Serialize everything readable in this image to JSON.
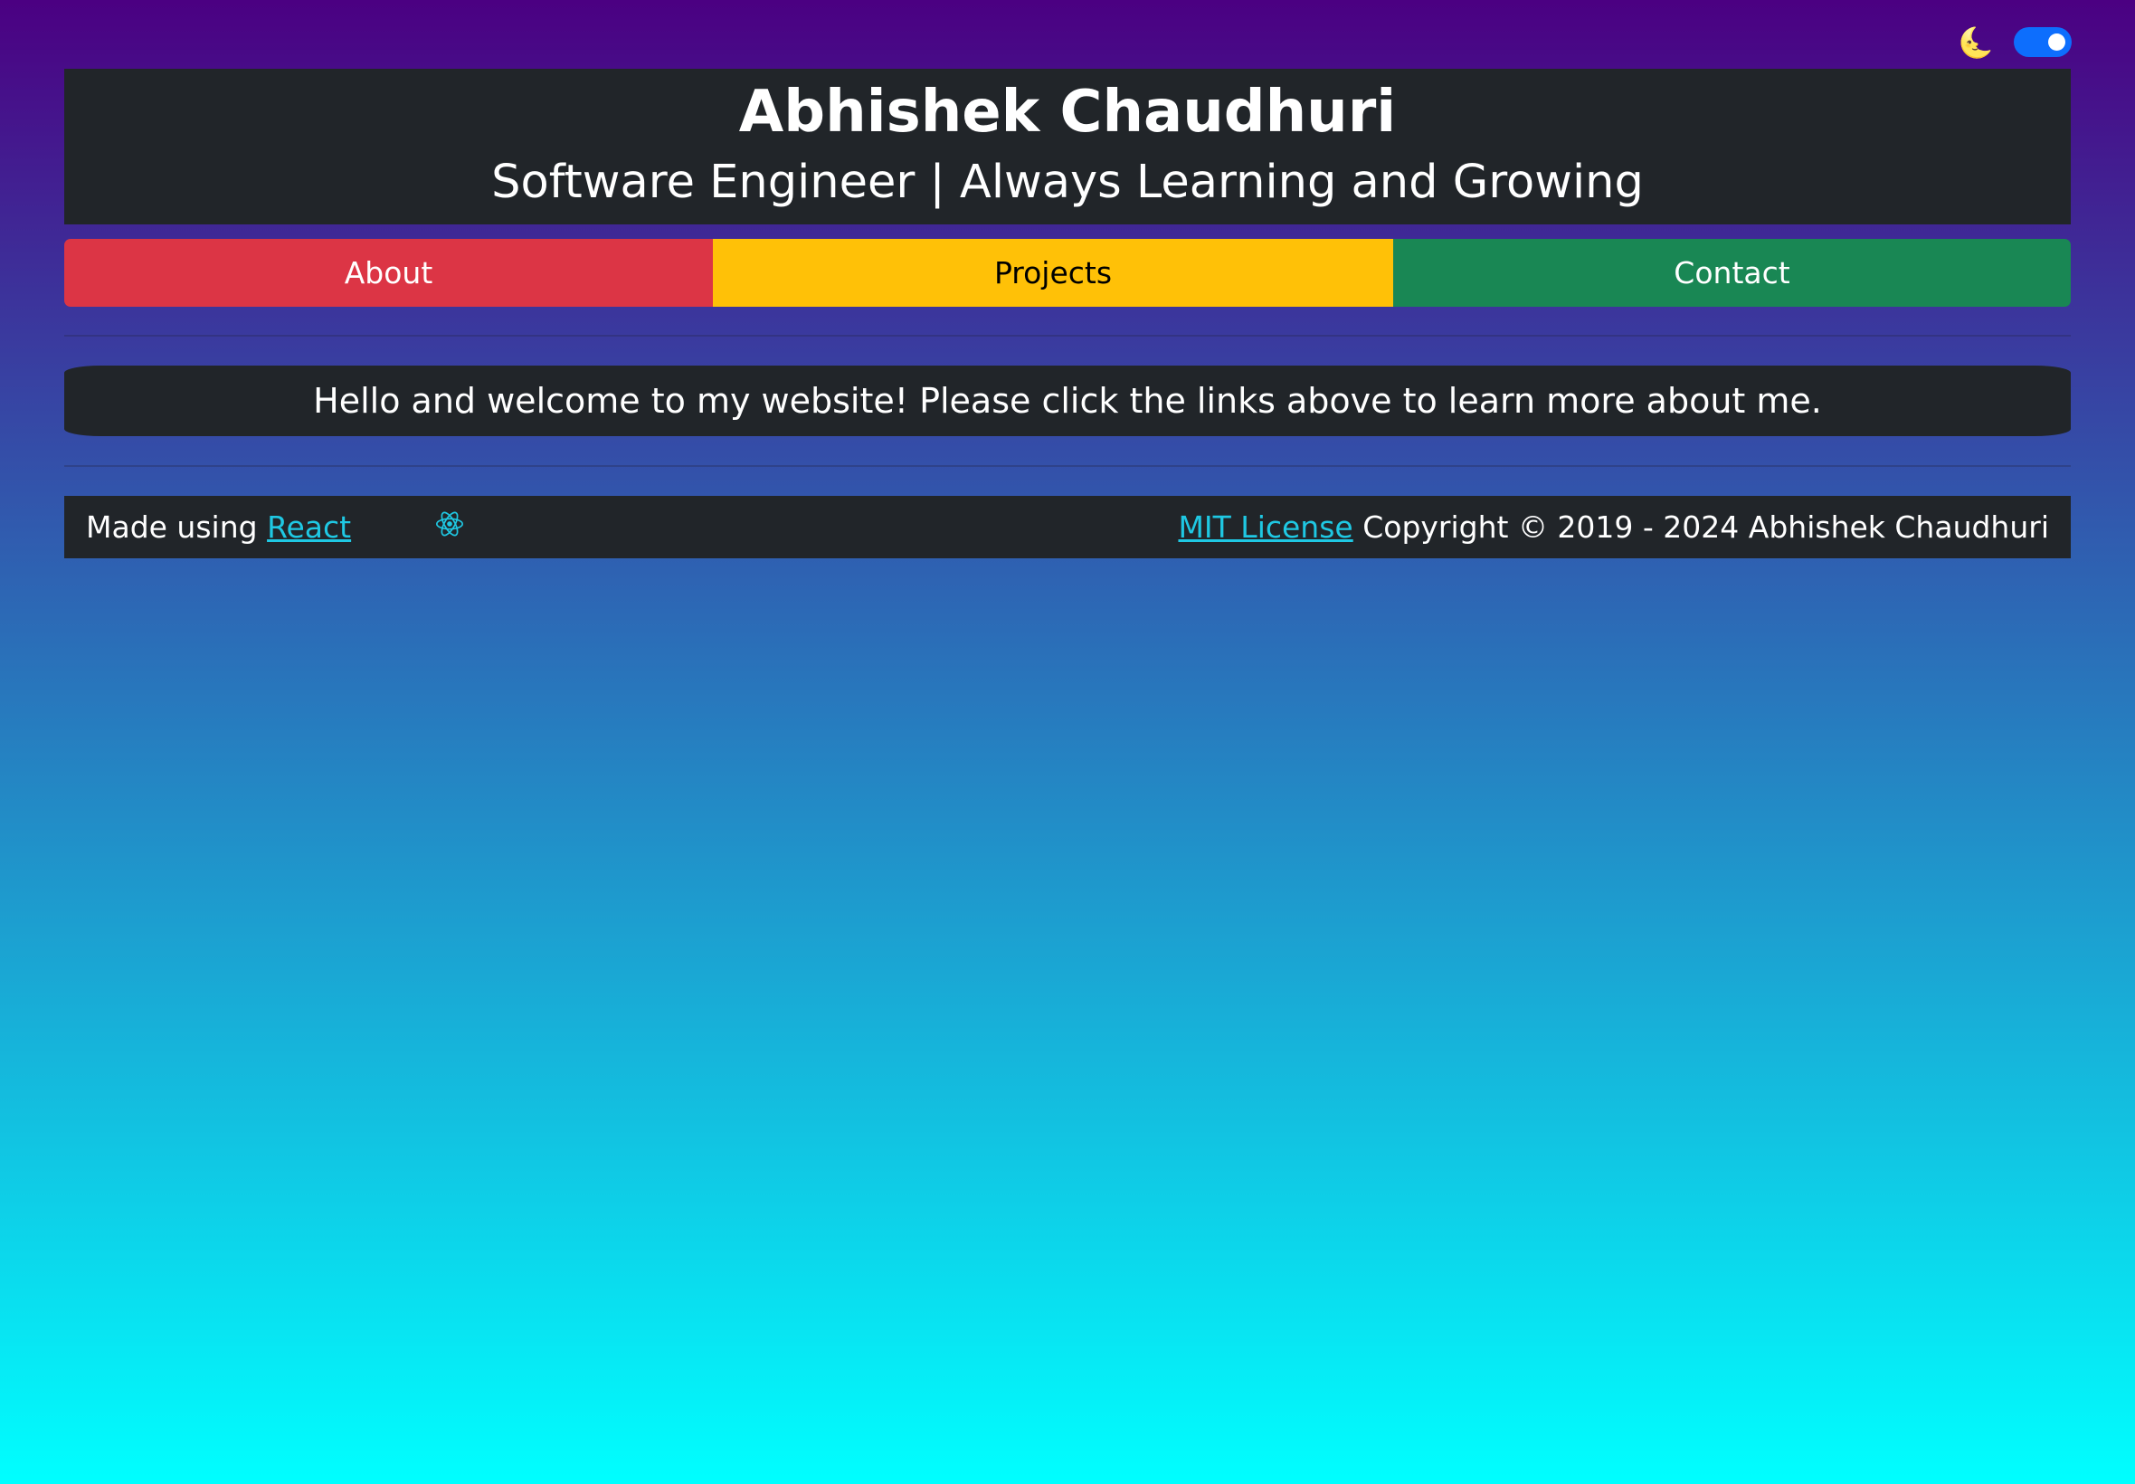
{
  "theme_toggle": {
    "icon": "moon-icon",
    "icon_glyph": "🌜",
    "state": "on",
    "color": "#0d6efd"
  },
  "header": {
    "title": "Abhishek Chaudhuri",
    "subtitle": "Software Engineer | Always Learning and Growing"
  },
  "nav": {
    "about": "About",
    "projects": "Projects",
    "contact": "Contact"
  },
  "welcome": {
    "text": "Hello and welcome to my website! Please click the links above to learn more about me."
  },
  "footer": {
    "made_using": "Made using ",
    "react_link": "React",
    "react_icon": "react-icon",
    "license_link": "MIT License",
    "copyright": " Copyright © 2019 - 2024 Abhishek Chaudhuri"
  },
  "colors": {
    "background_top": "#4b0082",
    "background_bottom": "#00ffff",
    "panel": "#212529",
    "about": "#dc3545",
    "projects": "#ffc107",
    "contact": "#198754",
    "link": "#1fc8e3"
  }
}
